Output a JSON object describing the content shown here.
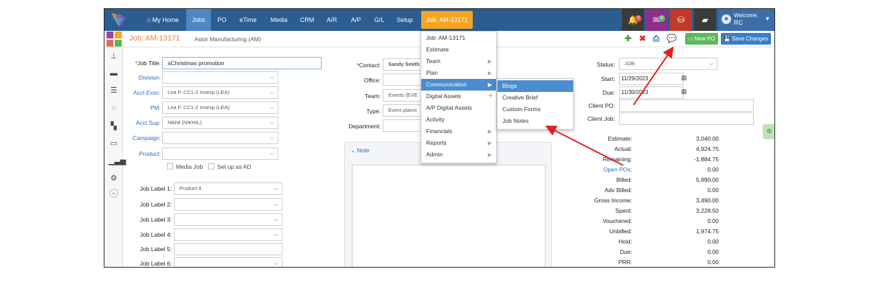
{
  "nav": {
    "items": [
      {
        "label": "My Home",
        "icon": "home-icon"
      },
      {
        "label": "Jobs"
      },
      {
        "label": "PO"
      },
      {
        "label": "eTime"
      },
      {
        "label": "Media"
      },
      {
        "label": "CRM"
      },
      {
        "label": "A/R"
      },
      {
        "label": "A/P"
      },
      {
        "label": "G/L"
      },
      {
        "label": "Setup"
      },
      {
        "label": "Job: AM-13171"
      }
    ],
    "bell_count": "0",
    "mail_count": "0",
    "welcome": "Welcome,",
    "user": "RC"
  },
  "job": {
    "title": "Job: AM-13171",
    "client": "Astor Manufacturing (AM)",
    "new_po": "New PO",
    "save_changes": "Save Changes"
  },
  "form": {
    "job_title_label": "Job Title:",
    "job_title_value": "sChristmas promotion",
    "division_label": "Division:",
    "acct_exec_label": "Acct Exec:",
    "acct_exec_value": "Lea P. CC1-2 msesp (LEA)",
    "pm_label": "PM:",
    "pm_value": "Lea P. CC1-2 msesp (LEA)",
    "acct_sup_label": "Acct Sup:",
    "acct_sup_value": "Nikhil (NIKHIL)",
    "campaign_label": "Campaign:",
    "product_label": "Product:",
    "media_job": "Media Job",
    "setup_ad": "Set up as AD",
    "job_labels": [
      {
        "label": "Job Label 1:",
        "value": "Product 4"
      },
      {
        "label": "Job Label 2:",
        "value": ""
      },
      {
        "label": "Job Label 3:",
        "value": ""
      },
      {
        "label": "Job Label 4:",
        "value": ""
      },
      {
        "label": "Job Label 5:",
        "value": ""
      },
      {
        "label": "Job Label 6:",
        "value": ""
      }
    ],
    "contact_label": "Contact:",
    "contact_value": "Sandy Smith",
    "office_label": "Office:",
    "team_label": "Team:",
    "team_value": "Events (EVE",
    "type_label": "Type:",
    "type_value": "Event planni",
    "department_label": "Department:",
    "note_label": "Note",
    "status_label": "Status:",
    "status_value": "JOB",
    "start_label": "Start:",
    "start_value": "11/29/2023",
    "due_label": "Due:",
    "due_value": "11/30/2023",
    "client_po_label": "Client PO:",
    "client_job_label": "Client Job:"
  },
  "menu": {
    "items": [
      {
        "label": "Job: AM-13171",
        "arrow": ""
      },
      {
        "label": "Estimate",
        "arrow": ""
      },
      {
        "label": "Team",
        "arrow": "▶"
      },
      {
        "label": "Plan",
        "arrow": "▶"
      },
      {
        "label": "Communication",
        "arrow": "▶"
      },
      {
        "label": "Digital Assets",
        "arrow": ""
      },
      {
        "label": "A/P Digital Assets",
        "arrow": ""
      },
      {
        "label": "Activity",
        "arrow": ""
      },
      {
        "label": "Financials",
        "arrow": "▶"
      },
      {
        "label": "Reports",
        "arrow": "▶"
      },
      {
        "label": "Admin",
        "arrow": "▶"
      }
    ],
    "plus": "+"
  },
  "submenu": {
    "items": [
      "Blogs",
      "Creative Brief",
      "Custom Forms",
      "Job Notes"
    ]
  },
  "summary": [
    {
      "label": "Estimate:",
      "value": "3,040.00"
    },
    {
      "label": "Actual:",
      "value": "4,924.75"
    },
    {
      "label": "Remaining:",
      "value": "-1,884.75"
    },
    {
      "label": "Open POs:",
      "value": "0.00"
    },
    {
      "label": "Billed:",
      "value": "5,990.00"
    },
    {
      "label": "Adv Billed:",
      "value": "0.00"
    },
    {
      "label": "Gross Income:",
      "value": "3,490.00"
    },
    {
      "label": "Spent:",
      "value": "3,228.50"
    },
    {
      "label": "Vouchered:",
      "value": "0.00"
    },
    {
      "label": "Unbilled:",
      "value": "1,974.75"
    },
    {
      "label": "Hold:",
      "value": "0.00"
    },
    {
      "label": "Due:",
      "value": "0.00"
    },
    {
      "label": "PRR:",
      "value": "0.00"
    }
  ],
  "colors": {
    "nav_bg": "#2c5d91",
    "accent_orange": "#f5a623",
    "highlight_blue": "#4a8dd0",
    "annotation_red": "#e0201e"
  }
}
